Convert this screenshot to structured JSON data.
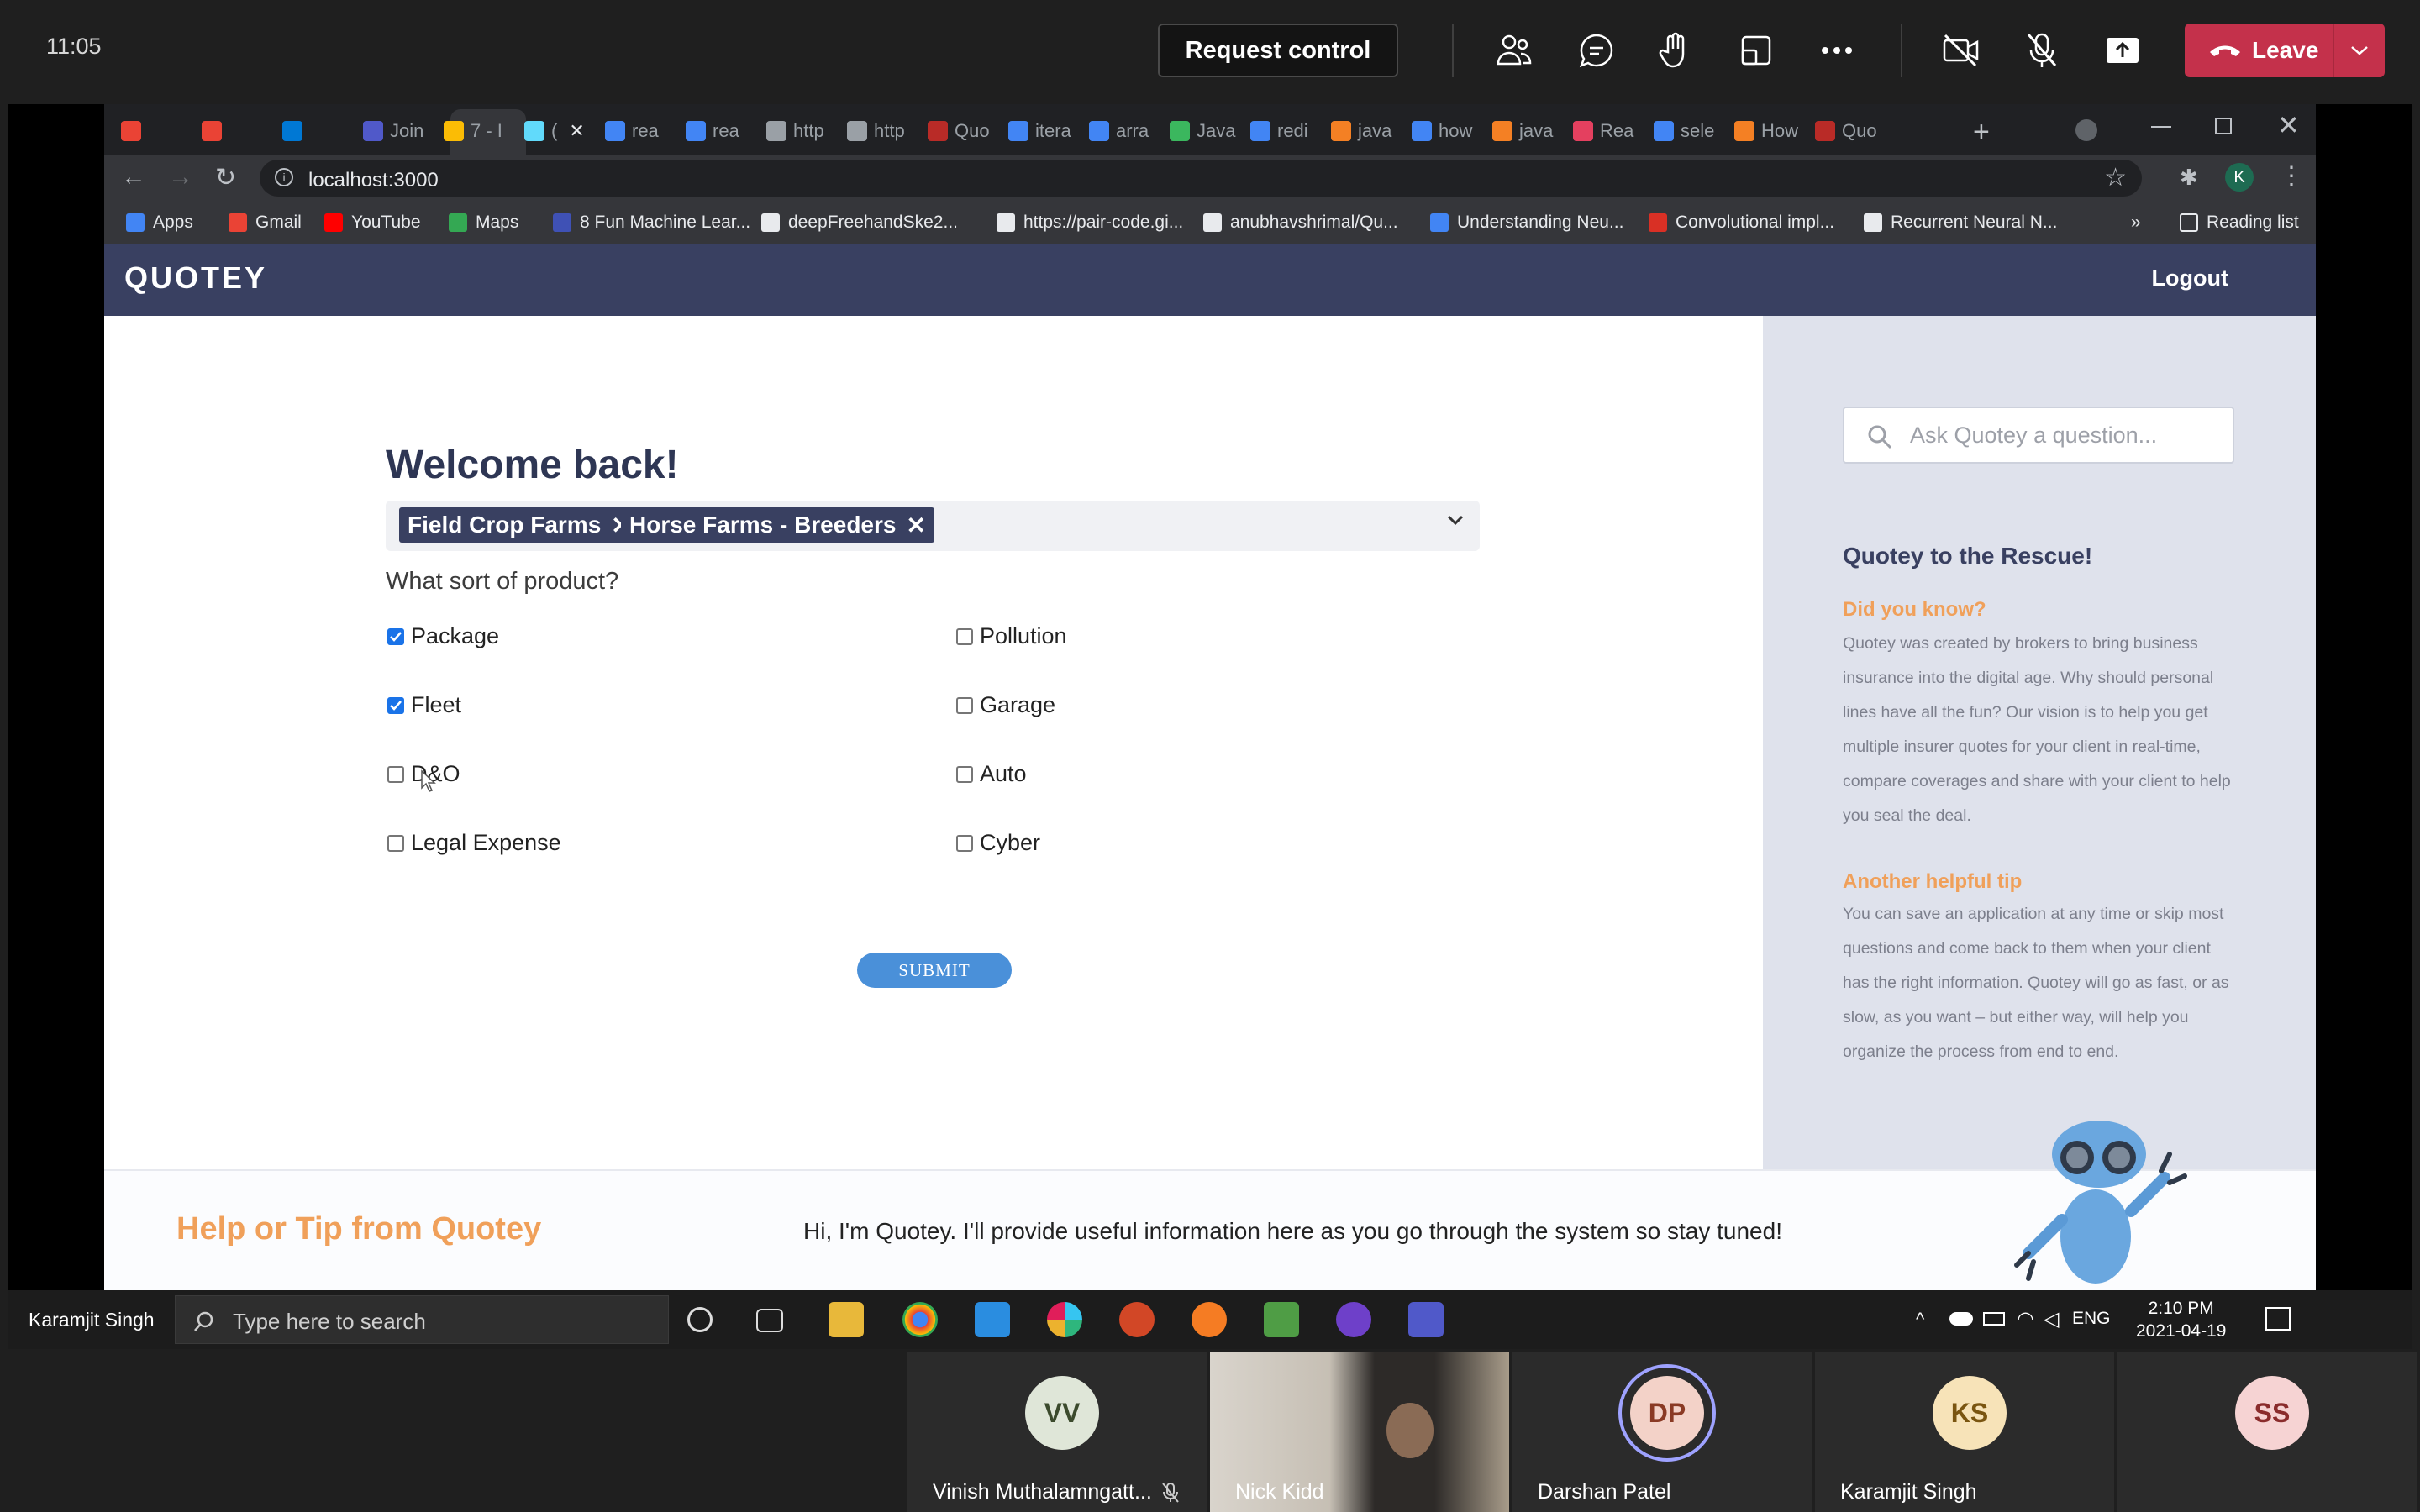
{
  "meeting": {
    "clock": "11:05",
    "request_control": "Request control",
    "leave": "Leave",
    "icons": [
      "people-icon",
      "chat-icon",
      "raise-hand-icon",
      "rooms-icon",
      "more-icon",
      "camera-off-icon",
      "mic-off-icon",
      "share-icon"
    ]
  },
  "browser": {
    "tabs": [
      "",
      "",
      "",
      "Join",
      "7 - I",
      "(",
      "rea",
      "rea",
      "http",
      "http",
      "Quo",
      "itera",
      "arra",
      "Java",
      "redi",
      "java",
      "how",
      "java",
      "Rea",
      "sele",
      "How",
      "Quo"
    ],
    "url": "localhost:3000",
    "bookmarks": [
      "Apps",
      "Gmail",
      "YouTube",
      "Maps",
      "8 Fun Machine Lear...",
      "deepFreehandSke2...",
      "https://pair-code.gi...",
      "anubhavshrimal/Qu...",
      "Understanding Neu...",
      "Convolutional impl...",
      "Recurrent Neural N..."
    ],
    "reading_list": "Reading list",
    "profile_initial": "K",
    "chevron": "»"
  },
  "app": {
    "brand": "QUOTEY",
    "logout": "Logout",
    "welcome": "Welcome back!",
    "selected_tags": [
      "Field Crop Farms",
      "Horse Farms - Breeders"
    ],
    "remove_glyph": "✕",
    "question": "What sort of product?",
    "products_left": [
      {
        "label": "Package",
        "checked": true
      },
      {
        "label": "Fleet",
        "checked": true
      },
      {
        "label": "D&O",
        "checked": false
      },
      {
        "label": "Legal Expense",
        "checked": false
      }
    ],
    "products_right": [
      {
        "label": "Pollution",
        "checked": false
      },
      {
        "label": "Garage",
        "checked": false
      },
      {
        "label": "Auto",
        "checked": false
      },
      {
        "label": "Cyber",
        "checked": false
      }
    ],
    "submit": "SUBMIT",
    "sidebar": {
      "ask_placeholder": "Ask Quotey a question...",
      "title": "Quotey to the Rescue!",
      "did_you_know_heading": "Did you know?",
      "did_you_know_text": "Quotey was created by brokers to bring business insurance into the digital age. Why should personal lines have all the fun? Our vision is to help you get multiple insurer quotes for your client in real-time, compare coverages and share with your client to help you seal the deal.",
      "tip_heading": "Another helpful tip",
      "tip_text": "You can save an application at any time or skip most questions and come back to them when your client has the right information. Quotey will go as fast, or as slow, as you want – but either way, will help you organize the process from end to end."
    },
    "help_title": "Help or Tip from Quotey",
    "help_text": "Hi, I'm Quotey. I'll provide useful information here as you go through the system so stay tuned!"
  },
  "taskbar": {
    "presenter": "Karamjit Singh",
    "search_placeholder": "Type here to search",
    "lang": "ENG",
    "time": "2:10 PM",
    "date": "2021-04-19"
  },
  "participants": [
    {
      "initials": "VV",
      "name": "Vinish Muthalamngatt...",
      "muted": true,
      "color": "#dfe6d8",
      "text_color": "#3b4a2c"
    },
    {
      "initials": "",
      "name": "Nick Kidd",
      "muted": false,
      "video": true
    },
    {
      "initials": "DP",
      "name": "Darshan Patel",
      "muted": false,
      "speaking": true,
      "color": "#f3d2c8",
      "text_color": "#8a3a24"
    },
    {
      "initials": "KS",
      "name": "Karamjit Singh",
      "muted": false,
      "color": "#f7e3b8",
      "text_color": "#7a5510"
    },
    {
      "initials": "SS",
      "name": "",
      "muted": false,
      "color": "#f6d3d3",
      "text_color": "#8a2c2c"
    }
  ]
}
